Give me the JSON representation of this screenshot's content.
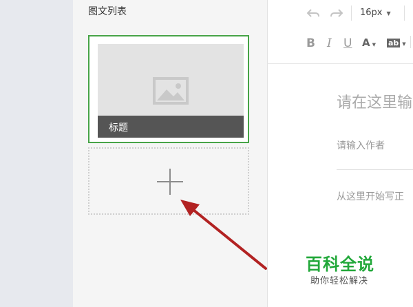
{
  "panel": {
    "title": "图文列表",
    "card": {
      "caption": "标题"
    }
  },
  "toolbar": {
    "font_size": "16px",
    "bold": "B",
    "italic": "I",
    "underline": "U",
    "font_color": "A",
    "highlight": "ab"
  },
  "editor": {
    "title_placeholder": "请在这里输",
    "author_placeholder": "请输入作者",
    "body_placeholder": "从这里开始写正"
  },
  "watermark": {
    "main": "百科全说",
    "sub": "助你轻松解决"
  },
  "colors": {
    "selected_border": "#47a447",
    "arrow": "#b22222",
    "watermark_green": "#22a83a"
  }
}
